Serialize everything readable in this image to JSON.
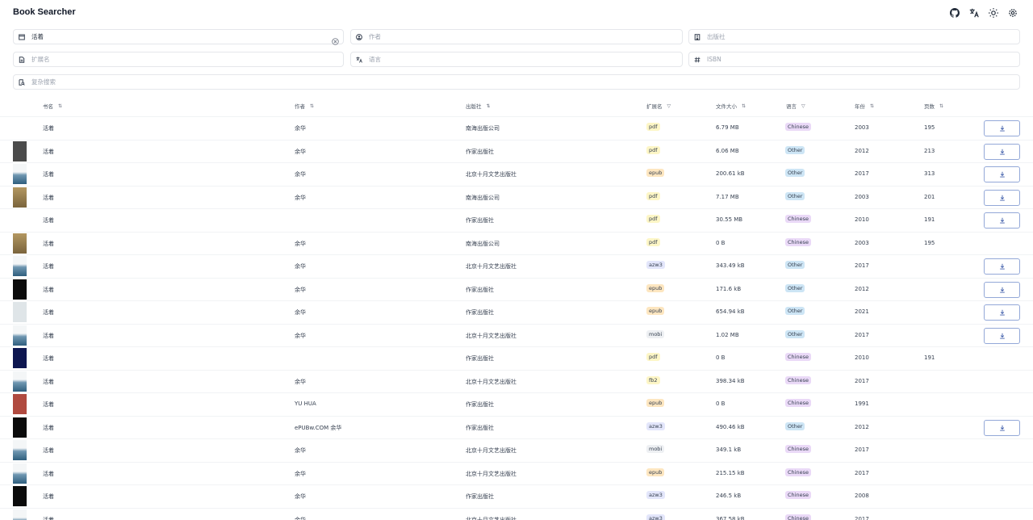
{
  "app": {
    "title": "Book Searcher"
  },
  "header_icons": [
    "github-icon",
    "translate-icon",
    "sun-icon",
    "settings-icon"
  ],
  "search": {
    "title": {
      "value": "活着",
      "placeholder": ""
    },
    "author": {
      "value": "",
      "placeholder": "作者"
    },
    "publisher": {
      "value": "",
      "placeholder": "出版社"
    },
    "extension": {
      "value": "",
      "placeholder": "扩展名"
    },
    "language": {
      "value": "",
      "placeholder": "语言"
    },
    "isbn": {
      "value": "",
      "placeholder": "ISBN"
    },
    "complex": {
      "value": "",
      "placeholder": "复杂搜索"
    }
  },
  "table": {
    "headers": {
      "title": "书名",
      "author": "作者",
      "publisher": "出版社",
      "extension": "扩展名",
      "filesize": "文件大小",
      "language": "语言",
      "year": "年份",
      "pages": "页数"
    },
    "rows": [
      {
        "cover": "none",
        "title": "活着",
        "author": "余华",
        "publisher": "南海出版公司",
        "ext": "pdf",
        "size": "6.79 MB",
        "lang": "Chinese",
        "year": "2003",
        "pages": "195",
        "download": true
      },
      {
        "cover": "gray",
        "title": "活着",
        "author": "余华",
        "publisher": "作家出版社",
        "ext": "pdf",
        "size": "6.06 MB",
        "lang": "Other",
        "year": "2012",
        "pages": "213",
        "download": true
      },
      {
        "cover": "sea",
        "title": "活着",
        "author": "余华",
        "publisher": "北京十月文艺出版社",
        "ext": "epub",
        "size": "200.61 kB",
        "lang": "Other",
        "year": "2017",
        "pages": "313",
        "download": true
      },
      {
        "cover": "tan",
        "title": "活着",
        "author": "余华",
        "publisher": "南海出版公司",
        "ext": "pdf",
        "size": "7.17 MB",
        "lang": "Other",
        "year": "2003",
        "pages": "201",
        "download": true
      },
      {
        "cover": "none",
        "title": "活着",
        "author": "",
        "publisher": "作家出版社",
        "ext": "pdf",
        "size": "30.55 MB",
        "lang": "Chinese",
        "year": "2010",
        "pages": "191",
        "download": true
      },
      {
        "cover": "tan",
        "title": "活着",
        "author": "余华",
        "publisher": "南海出版公司",
        "ext": "pdf",
        "size": "0 B",
        "lang": "Chinese",
        "year": "2003",
        "pages": "195",
        "download": false
      },
      {
        "cover": "sea",
        "title": "活着",
        "author": "余华",
        "publisher": "北京十月文艺出版社",
        "ext": "azw3",
        "size": "343.49 kB",
        "lang": "Other",
        "year": "2017",
        "pages": "",
        "download": true
      },
      {
        "cover": "black",
        "title": "活着",
        "author": "余华",
        "publisher": "作家出版社",
        "ext": "epub",
        "size": "171.6 kB",
        "lang": "Other",
        "year": "2012",
        "pages": "",
        "download": true
      },
      {
        "cover": "light",
        "title": "活着",
        "author": "余华",
        "publisher": "作家出版社",
        "ext": "epub",
        "size": "654.94 kB",
        "lang": "Other",
        "year": "2021",
        "pages": "",
        "download": true
      },
      {
        "cover": "sea",
        "title": "活着",
        "author": "余华",
        "publisher": "北京十月文艺出版社",
        "ext": "mobi",
        "size": "1.02 MB",
        "lang": "Other",
        "year": "2017",
        "pages": "",
        "download": true
      },
      {
        "cover": "navy",
        "title": "活着",
        "author": "",
        "publisher": "作家出版社",
        "ext": "pdf",
        "size": "0 B",
        "lang": "Chinese",
        "year": "2010",
        "pages": "191",
        "download": false
      },
      {
        "cover": "sea",
        "title": "活着",
        "author": "余华",
        "publisher": "北京十月文艺出版社",
        "ext": "fb2",
        "size": "398.34 kB",
        "lang": "Chinese",
        "year": "2017",
        "pages": "",
        "download": false
      },
      {
        "cover": "red",
        "title": "活着",
        "author": "YU HUA",
        "publisher": "作家出版社",
        "ext": "epub",
        "size": "0 B",
        "lang": "Chinese",
        "year": "1991",
        "pages": "",
        "download": false
      },
      {
        "cover": "black",
        "title": "活着",
        "author": "ePUBw.COM 余华",
        "publisher": "作家出版社",
        "ext": "azw3",
        "size": "490.46 kB",
        "lang": "Other",
        "year": "2012",
        "pages": "",
        "download": true
      },
      {
        "cover": "sea",
        "title": "活着",
        "author": "余华",
        "publisher": "北京十月文艺出版社",
        "ext": "mobi",
        "size": "349.1 kB",
        "lang": "Chinese",
        "year": "2017",
        "pages": "",
        "download": false
      },
      {
        "cover": "sea",
        "title": "活着",
        "author": "余华",
        "publisher": "北京十月文艺出版社",
        "ext": "epub",
        "size": "215.15 kB",
        "lang": "Chinese",
        "year": "2017",
        "pages": "",
        "download": false
      },
      {
        "cover": "black",
        "title": "活着",
        "author": "余华",
        "publisher": "作家出版社",
        "ext": "azw3",
        "size": "246.5 kB",
        "lang": "Chinese",
        "year": "2008",
        "pages": "",
        "download": false
      },
      {
        "cover": "sea",
        "title": "活着",
        "author": "余华",
        "publisher": "北京十月文艺出版社",
        "ext": "azw3",
        "size": "367.58 kB",
        "lang": "Chinese",
        "year": "2017",
        "pages": "",
        "download": false
      }
    ]
  },
  "colors": {
    "ext": {
      "pdf": "#fdf6c6",
      "epub": "#fde6c0",
      "azw3": "#e3e6fb",
      "mobi": "#eef0f3",
      "fb2": "#fdf6c6"
    },
    "lang": {
      "Chinese": "#ead9f7",
      "Other": "#cde5f5"
    },
    "cover": {
      "gray": "#4b4b4b",
      "sea": "#5b8aa8",
      "tan": "#b39761",
      "black": "#0b0b0b",
      "light": "#dfe5e8",
      "navy": "#0d1650",
      "red": "#b04a3f"
    }
  }
}
